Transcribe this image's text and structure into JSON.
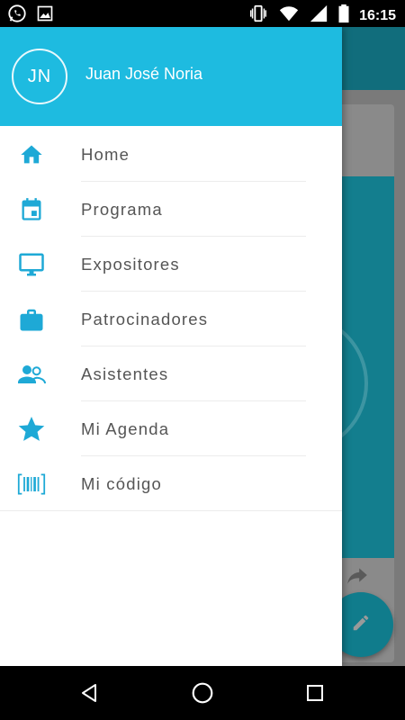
{
  "status_bar": {
    "time": "16:15",
    "left_icons": [
      "whatsapp-icon",
      "image-icon"
    ],
    "right_icons": [
      "vibrate-icon",
      "wifi-icon",
      "signal-icon",
      "battery-icon"
    ]
  },
  "drawer": {
    "header": {
      "avatar_initials": "JN",
      "user_name": "Juan José Noria",
      "color": "#1ebbe0"
    },
    "items": [
      {
        "label": "Home",
        "icon": "home-icon"
      },
      {
        "label": "Programa",
        "icon": "calendar-icon"
      },
      {
        "label": "Expositores",
        "icon": "monitor-icon"
      },
      {
        "label": "Patrocinadores",
        "icon": "briefcase-icon"
      },
      {
        "label": "Asistentes",
        "icon": "people-icon"
      },
      {
        "label": "Mi Agenda",
        "icon": "star-icon"
      },
      {
        "label": "Mi código",
        "icon": "barcode-icon"
      }
    ]
  },
  "background_app": {
    "fab_icon": "edit-icon",
    "share_icon": "share-icon"
  },
  "nav_bar": {
    "buttons": [
      "back-icon",
      "home-circle-icon",
      "recents-icon"
    ]
  },
  "colors": {
    "accent": "#1ebbe0",
    "icon": "#1ea9d6",
    "text": "#555555"
  }
}
